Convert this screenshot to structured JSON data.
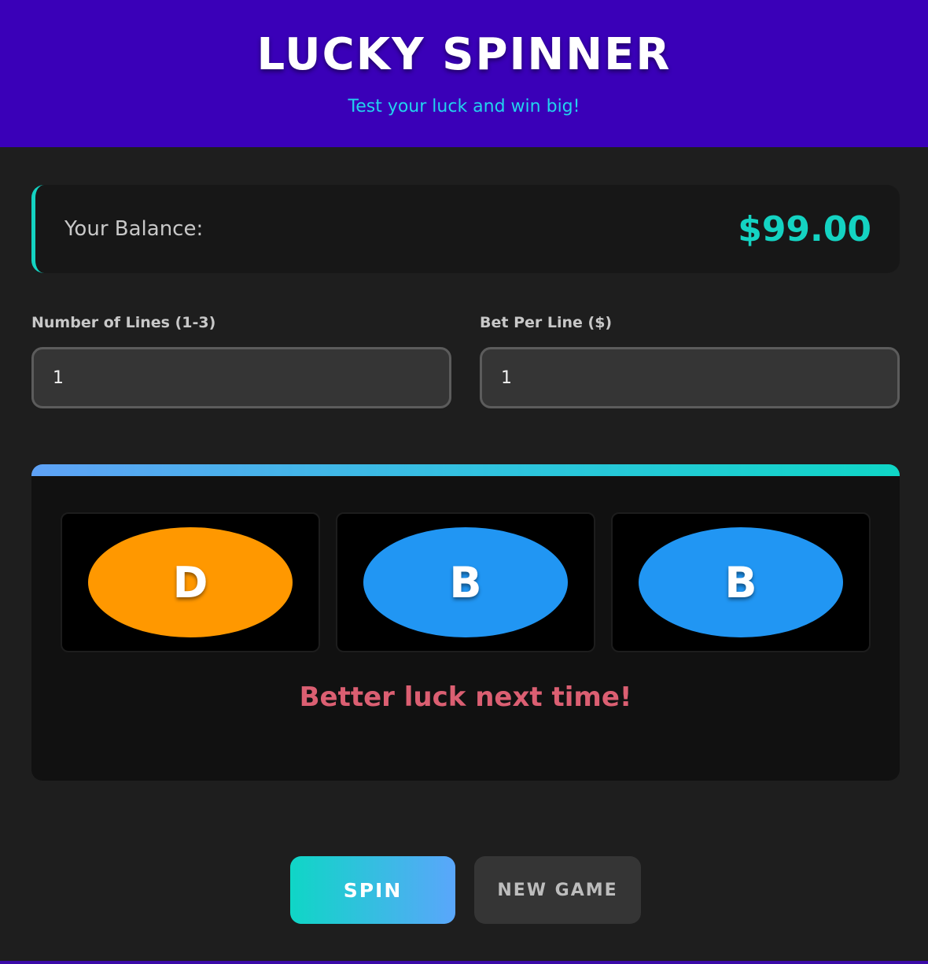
{
  "header": {
    "title": "LUCKY SPINNER",
    "subtitle": "Test your luck and win big!"
  },
  "balance": {
    "label": "Your Balance:",
    "value": "$99.00"
  },
  "inputs": {
    "lines": {
      "label": "Number of Lines (1-3)",
      "value": "1"
    },
    "bet": {
      "label": "Bet Per Line ($)",
      "value": "1"
    }
  },
  "reels": [
    {
      "symbol": "D",
      "color": "#ff9800"
    },
    {
      "symbol": "B",
      "color": "#2196f3"
    },
    {
      "symbol": "B",
      "color": "#2196f3"
    }
  ],
  "result_message": "Better luck next time!",
  "buttons": {
    "spin": "SPIN",
    "new_game": "NEW GAME"
  },
  "colors": {
    "header_bg": "#3a00b8",
    "accent": "#14d3c2",
    "lose_text": "#db5f72"
  }
}
